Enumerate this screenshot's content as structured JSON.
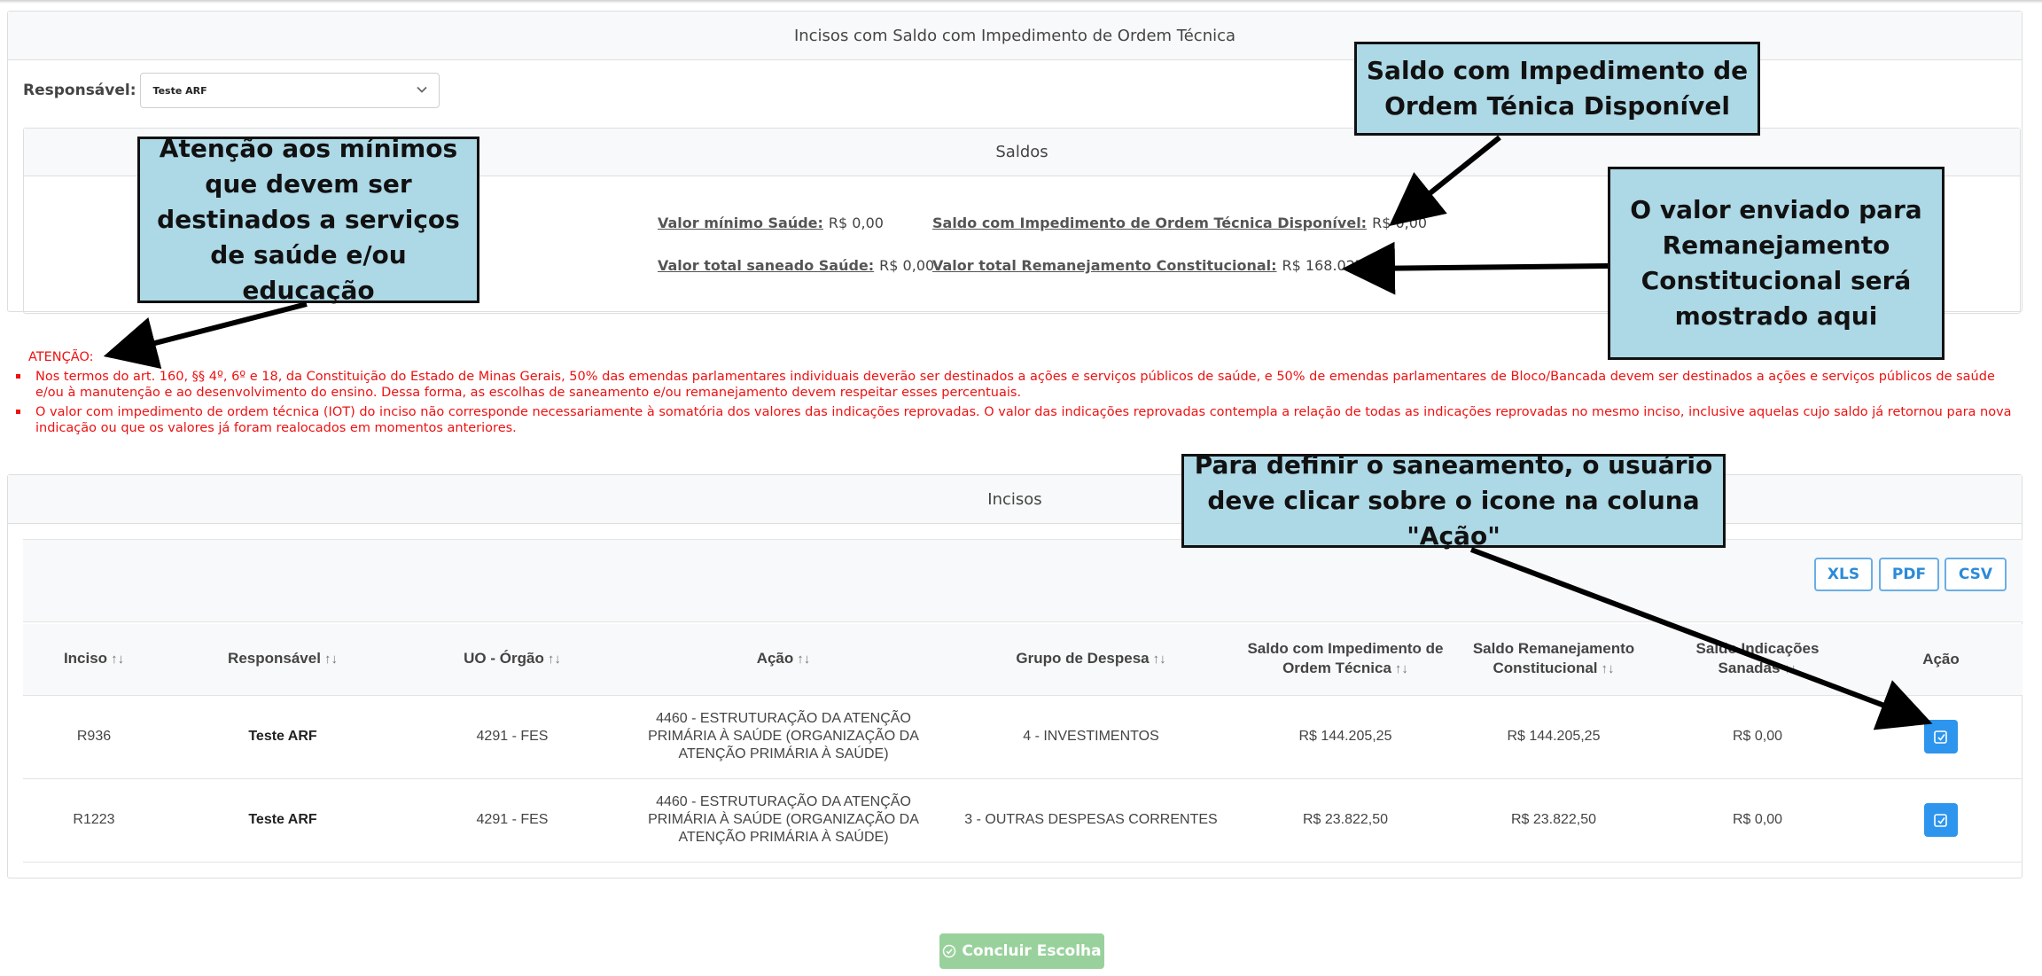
{
  "main_panel": {
    "title": "Incisos com Saldo com Impedimento de Ordem Técnica"
  },
  "responsavel": {
    "label": "Responsável:",
    "selected": "Teste ARF"
  },
  "saldos": {
    "title": "Saldos",
    "valor_minimo_saude": {
      "label": "Valor mínimo Saúde:",
      "value": "R$ 0,00"
    },
    "valor_total_saneado_saude": {
      "label": "Valor total saneado Saúde:",
      "value": "R$ 0,00"
    },
    "saldo_iot_disponivel": {
      "label": "Saldo com Impedimento de Ordem Técnica Disponível:",
      "value": "R$ 0,00"
    },
    "valor_total_remanejamento": {
      "label": "Valor total Remanejamento Constitucional:",
      "value": "R$ 168.027,75"
    }
  },
  "attention": {
    "title": "ATENÇÃO:",
    "items": [
      "Nos termos do art. 160, §§ 4º, 6º e 18, da Constituição do Estado de Minas Gerais, 50% das emendas parlamentares individuais deverão ser destinados a ações e serviços públicos de saúde, e 50% de emendas parlamentares de Bloco/Bancada devem ser destinados a ações e serviços públicos de saúde e/ou à manutenção e ao desenvolvimento do ensino. Dessa forma, as escolhas de saneamento e/ou remanejamento devem respeitar esses percentuais.",
      "O valor com impedimento de ordem técnica (IOT) do inciso não corresponde necessariamente à somatória dos valores das indicações reprovadas. O valor das indicações reprovadas contempla a relação de todas as indicações reprovadas no mesmo inciso, inclusive aquelas cujo saldo já retornou para nova indicação ou que os valores já foram realocados em momentos anteriores."
    ]
  },
  "incisos": {
    "title": "Incisos",
    "export_buttons": {
      "xls": "XLS",
      "pdf": "PDF",
      "csv": "CSV"
    },
    "columns": {
      "inciso": "Inciso",
      "responsavel": "Responsável",
      "uo_orgao": "UO - Órgão",
      "acao": "Ação",
      "grupo_despesa": "Grupo de Despesa",
      "saldo_iot": "Saldo com Impedimento de Ordem Técnica",
      "saldo_remanejamento": "Saldo Remanejamento Constitucional",
      "saldo_indicacoes": "Saldo Indicações Sanadas",
      "acao_btn": "Ação"
    },
    "sort_glyph": "↑↓",
    "rows": [
      {
        "inciso": "R936",
        "responsavel": "Teste ARF",
        "uo_orgao": "4291 - FES",
        "acao": "4460 - ESTRUTURAÇÃO DA ATENÇÃO PRIMÁRIA À SAÚDE (ORGANIZAÇÃO DA ATENÇÃO PRIMÁRIA À SAÚDE)",
        "grupo_despesa": "4 - INVESTIMENTOS",
        "saldo_iot": "R$ 144.205,25",
        "saldo_remanejamento": "R$ 144.205,25",
        "saldo_indicacoes": "R$ 0,00"
      },
      {
        "inciso": "R1223",
        "responsavel": "Teste ARF",
        "uo_orgao": "4291 - FES",
        "acao": "4460 - ESTRUTURAÇÃO DA ATENÇÃO PRIMÁRIA À SAÚDE (ORGANIZAÇÃO DA ATENÇÃO PRIMÁRIA À SAÚDE)",
        "grupo_despesa": "3 - OUTRAS DESPESAS CORRENTES",
        "saldo_iot": "R$ 23.822,50",
        "saldo_remanejamento": "R$ 23.822,50",
        "saldo_indicacoes": "R$ 0,00"
      }
    ],
    "action_icon": "edit-square-icon"
  },
  "concluir_button": {
    "label": "Concluir Escolha",
    "icon": "check-circle-icon"
  },
  "callouts": {
    "saldo_disponivel": "Saldo com Impedimento de Ordem Ténica Disponível",
    "minimos": "Atenção aos mínimos que devem ser destinados a serviços de saúde e/ou educação",
    "remanejamento": "O valor enviado para Remanejamento Constitucional será mostrado aqui",
    "saneamento": "Para definir o saneamento, o usuário deve clicar sobre o icone na coluna \"Ação\""
  },
  "colors": {
    "accent_blue": "#2d95ee",
    "attention_red": "#ee1111",
    "callout_bg": "#add8e6",
    "success_green": "#99d19c"
  }
}
